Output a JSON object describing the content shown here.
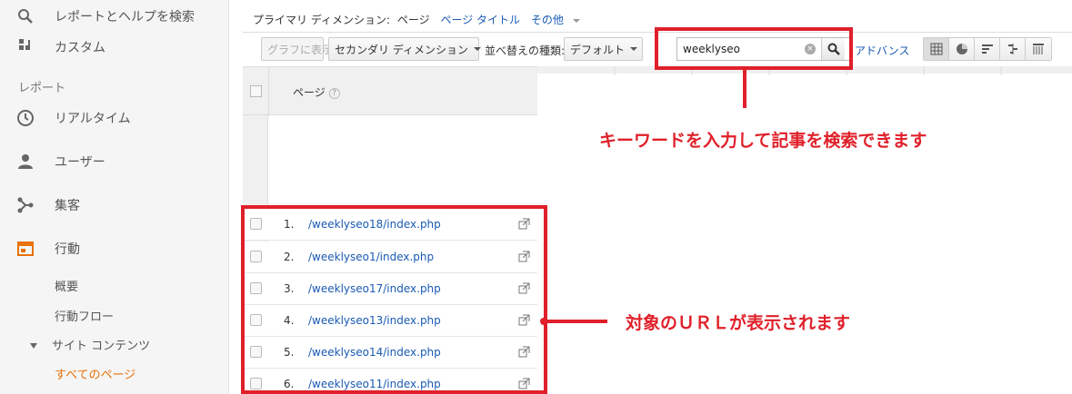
{
  "sidebar": {
    "search_label": "レポートとヘルプを検索",
    "custom_label": "カスタム",
    "section_reports": "レポート",
    "items": [
      {
        "label": "リアルタイム",
        "icon": "clock-icon"
      },
      {
        "label": "ユーザー",
        "icon": "person-icon"
      },
      {
        "label": "集客",
        "icon": "acquisition-icon"
      },
      {
        "label": "行動",
        "icon": "behavior-icon"
      }
    ],
    "sub_overview": "概要",
    "sub_flow": "行動フロー",
    "sub_site_content": "サイト コンテンツ",
    "sub_all_pages": "すべてのページ",
    "active_color": "#e8710a"
  },
  "dimension_bar": {
    "label": "プライマリ ディメンション:",
    "active": "ページ",
    "link1": "ページ タイトル",
    "link2": "その他"
  },
  "toolbar": {
    "graph_button": "グラフに表示",
    "secondary_dim": "セカンダリ ディメンション",
    "sort_label": "並べ替えの種類:",
    "sort_value": "デフォルト",
    "search_value": "weeklyseo",
    "advance_label": "アドバンス"
  },
  "table": {
    "header_page": "ページ",
    "rows": [
      {
        "num": "1.",
        "link": "/weeklyseo18/index.php"
      },
      {
        "num": "2.",
        "link": "/weeklyseo1/index.php"
      },
      {
        "num": "3.",
        "link": "/weeklyseo17/index.php"
      },
      {
        "num": "4.",
        "link": "/weeklyseo13/index.php"
      },
      {
        "num": "5.",
        "link": "/weeklyseo14/index.php"
      },
      {
        "num": "6.",
        "link": "/weeklyseo11/index.php"
      }
    ]
  },
  "annotations": {
    "search_note": "キーワードを入力して記事を検索できます",
    "url_note": "対象のＵＲＬが表示されます",
    "color": "#e0202a"
  }
}
